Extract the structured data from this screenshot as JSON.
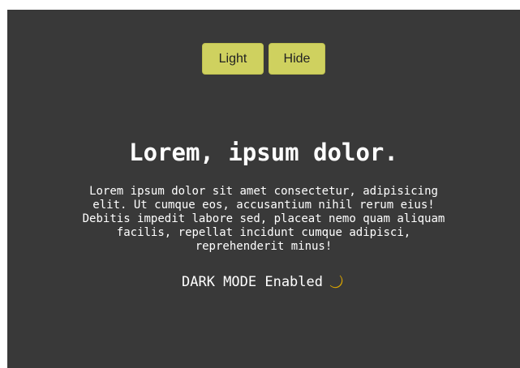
{
  "buttons": {
    "light_label": "Light",
    "hide_label": "Hide"
  },
  "content": {
    "title": "Lorem, ipsum dolor.",
    "paragraph": "Lorem ipsum dolor sit amet consectetur, adipisicing elit. Ut cumque eos, accusantium nihil rerum eius! Debitis impedit labore sed, placeat nemo quam aliquam facilis, repellat incidunt cumque adipisci, reprehenderit minus!",
    "status_text": "DARK MODE Enabled",
    "status_icon": "crescent-moon-icon"
  },
  "colors": {
    "page_bg": "#393939",
    "button_bg": "#cfd15f",
    "text": "#ffffff",
    "moon": "#f5c518"
  }
}
